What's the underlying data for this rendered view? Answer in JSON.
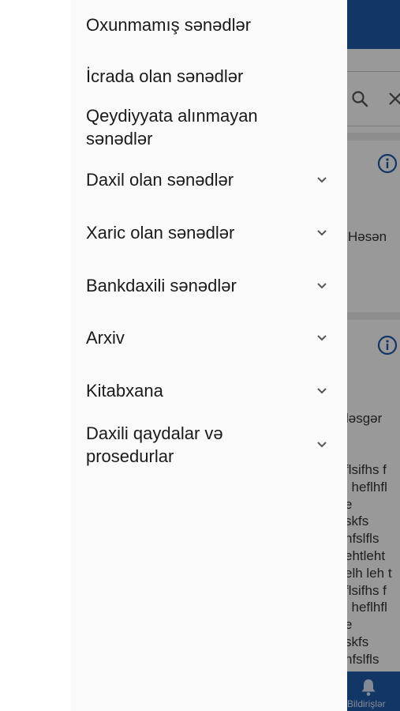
{
  "drawer": {
    "items": [
      {
        "label": "Oxunmamış sənədlər",
        "expandable": false
      },
      {
        "label": "İcrada olan sənədlər",
        "expandable": false
      },
      {
        "label": "Qeydiyyata alınmayan sənədlər",
        "expandable": false
      },
      {
        "label": "Daxil olan sənədlər",
        "expandable": true
      },
      {
        "label": "Xaric olan sənədlər",
        "expandable": true
      },
      {
        "label": "Bankdaxili sənədlər",
        "expandable": true
      },
      {
        "label": "Arxiv",
        "expandable": true
      },
      {
        "label": "Kitabxana",
        "expandable": true
      },
      {
        "label": "Daxili qaydalar və prosedurlar",
        "expandable": true
      }
    ]
  },
  "background": {
    "card1_name": "Həsən",
    "card2_name": "ləsgər",
    "card2_body": "flsifhs f\nl heflhfl\ne\nskfs\nhfslfls\nehtleht\nelh leh t\nflsifhs f\nl heflhfl\ne\nskfs\nhfslfls",
    "bottom_nav_label": "Bildirişlər"
  },
  "colors": {
    "brand_blue": "#1e5aa8",
    "drawer_bg": "#fafafa",
    "scrim": "rgba(0,0,0,0.40)"
  },
  "icons": {
    "search": "search-icon",
    "clear": "close-icon",
    "info": "info-icon",
    "chevron": "chevron-down-icon",
    "bell": "bell-icon"
  }
}
